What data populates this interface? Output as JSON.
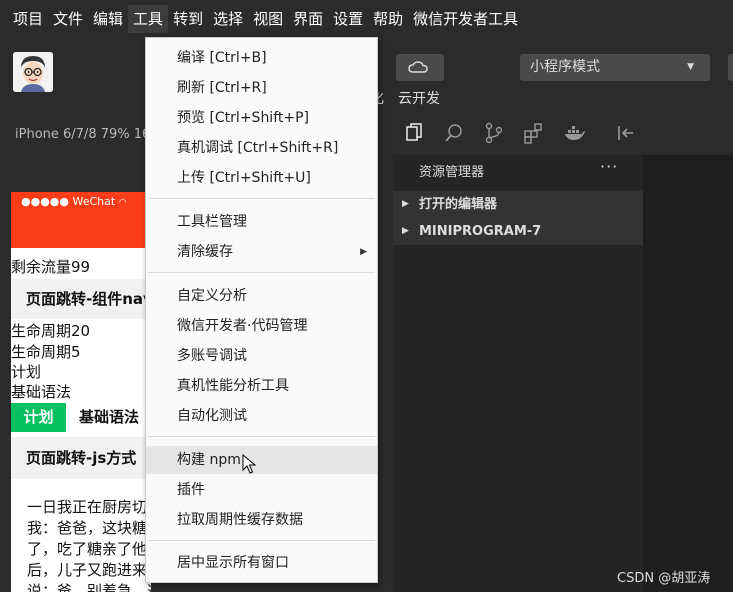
{
  "menubar": {
    "items": [
      "项目",
      "文件",
      "编辑",
      "工具",
      "转到",
      "选择",
      "视图",
      "界面",
      "设置",
      "帮助",
      "微信开发者工具"
    ],
    "active_index": 3
  },
  "toolbar": {
    "mode_select": "小程序模式",
    "cloud_label": "云开发",
    "visual_partial": "化"
  },
  "status": {
    "device": "iPhone 6/7/8 79% 16"
  },
  "simulator": {
    "status_bar": "●●●●● WeChat",
    "remaining": "剩余流量99",
    "jump_component": "页面跳转-组件nav",
    "lifecycle20": "生命周期20",
    "lifecycle5": "生命周期5",
    "plan": "计划",
    "basic": "基础语法",
    "plan_button": "计划",
    "basic_label": "基础语法",
    "jump_js": "页面跳转-js方式",
    "story_lines": [
      "一日我正在厨房切",
      "我：爸爸，这块糖",
      "了，吃了糖亲了他",
      "后，儿子又跑进来",
      "说：爸，别着急，这一块很快就好了。"
    ]
  },
  "explorer": {
    "title": "资源管理器",
    "more": "···",
    "sections": [
      "打开的编辑器",
      "MINIPROGRAM-7"
    ]
  },
  "dropdown": {
    "groups": [
      [
        "编译  [Ctrl+B]",
        "刷新  [Ctrl+R]",
        "预览  [Ctrl+Shift+P]",
        "真机调试  [Ctrl+Shift+R]",
        "上传  [Ctrl+Shift+U]"
      ],
      [
        "工具栏管理",
        "清除缓存"
      ],
      [
        "自定义分析",
        "微信开发者·代码管理",
        "多账号调试",
        "真机性能分析工具",
        "自动化测试"
      ],
      [
        "构建 npm",
        "插件",
        "拉取周期性缓存数据"
      ],
      [
        "居中显示所有窗口"
      ]
    ],
    "hovered": "构建 npm",
    "has_submenu": "清除缓存"
  },
  "watermark": "CSDN @胡亚涛",
  "colors": {
    "wechat_red": "#fa3c19",
    "plan_green": "#07c160",
    "dark_bg": "#2b2b2b",
    "menu_bg": "#fafafa",
    "hover_bg": "#e5e5e5"
  }
}
